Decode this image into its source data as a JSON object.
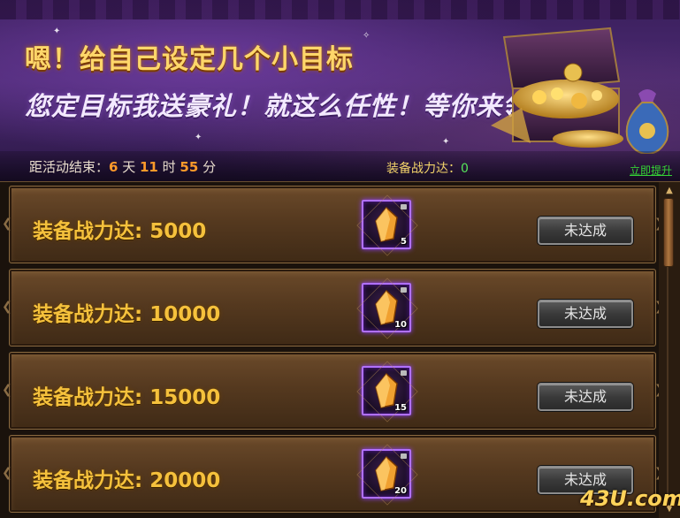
{
  "banner": {
    "headline": "嗯！给自己设定几个小目标",
    "subline": "您定目标我送豪礼！就这么任性！等你来领！"
  },
  "countdown": {
    "prefix": "距活动结束：",
    "days": "6",
    "days_unit": " 天 ",
    "hours": "11",
    "hours_unit": " 时 ",
    "minutes": "55",
    "minutes_unit": " 分"
  },
  "power": {
    "label": "装备战力达：",
    "value": "0",
    "upgrade_link": "立即提升"
  },
  "goals": [
    {
      "requirement": "装备战力达: 5000",
      "reward_qty": "5",
      "button": "未达成"
    },
    {
      "requirement": "装备战力达: 10000",
      "reward_qty": "10",
      "button": "未达成"
    },
    {
      "requirement": "装备战力达: 15000",
      "reward_qty": "15",
      "button": "未达成"
    },
    {
      "requirement": "装备战力达: 20000",
      "reward_qty": "20",
      "button": "未达成"
    }
  ],
  "icons": {
    "reward": "orange-crystal-icon",
    "lock": "lock-icon",
    "scroll_up": "arrow-up-icon",
    "scroll_down": "arrow-down-icon"
  },
  "colors": {
    "gold_text": "#f5c13c",
    "countdown_number": "#ff9a2a",
    "power_value": "#56e65a",
    "item_border": "#b070ff"
  },
  "watermark": "43U.com"
}
